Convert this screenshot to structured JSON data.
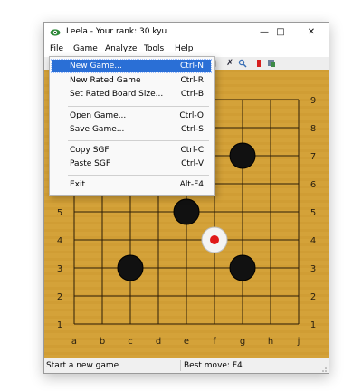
{
  "window": {
    "title": "Leela - Your rank: 30 kyu"
  },
  "menubar": {
    "items": [
      "File",
      "Game",
      "Analyze",
      "Tools",
      "Help"
    ]
  },
  "file_menu": {
    "items": [
      {
        "label": "New Game...",
        "accel": "Ctrl-N"
      },
      {
        "label": "New Rated Game",
        "accel": "Ctrl-R"
      },
      {
        "label": "Set Rated Board Size...",
        "accel": "Ctrl-B"
      },
      {
        "label": "Open Game...",
        "accel": "Ctrl-O"
      },
      {
        "label": "Save Game...",
        "accel": "Ctrl-S"
      },
      {
        "label": "Copy SGF",
        "accel": "Ctrl-C"
      },
      {
        "label": "Paste SGF",
        "accel": "Ctrl-V"
      },
      {
        "label": "Exit",
        "accel": "Alt-F4"
      }
    ]
  },
  "board": {
    "size": 9,
    "col_labels": [
      "a",
      "b",
      "c",
      "d",
      "e",
      "f",
      "g",
      "h",
      "j"
    ],
    "row_labels": [
      "9",
      "8",
      "7",
      "6",
      "5",
      "4",
      "3",
      "2",
      "1"
    ],
    "stones": [
      {
        "point": "g7",
        "color": "black"
      },
      {
        "point": "e5",
        "color": "black"
      },
      {
        "point": "c3",
        "color": "black"
      },
      {
        "point": "g3",
        "color": "black"
      },
      {
        "point": "f4",
        "color": "white",
        "last_move": true
      }
    ],
    "colors": {
      "wood": "#d4a239",
      "wood_dark": "#c38f28",
      "line": "#2b1d08",
      "black_stone": "#111111",
      "white_stone": "#f4f4f4",
      "marker": "#e01818"
    }
  },
  "status": {
    "left": "Start a new game",
    "right": "Best move: F4"
  }
}
